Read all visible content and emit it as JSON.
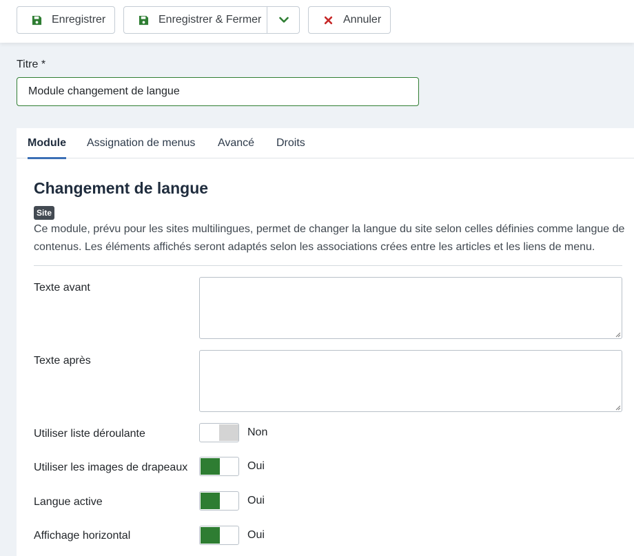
{
  "toolbar": {
    "save_label": "Enregistrer",
    "save_close_label": "Enregistrer & Fermer",
    "cancel_label": "Annuler"
  },
  "title_field": {
    "label": "Titre *",
    "value": "Module changement de langue"
  },
  "tabs": [
    {
      "label": "Module",
      "active": true
    },
    {
      "label": "Assignation de menus",
      "active": false
    },
    {
      "label": "Avancé",
      "active": false
    },
    {
      "label": "Droits",
      "active": false
    }
  ],
  "module": {
    "title": "Changement de langue",
    "badge": "Site",
    "description": "Ce module, prévu pour les sites multilingues, permet de changer la langue du site selon celles définies comme langue de contenus. Les éléments affichés seront adaptés selon les associations crées entre les articles et les liens de menu."
  },
  "fields": {
    "text_before": {
      "label": "Texte avant",
      "value": ""
    },
    "text_after": {
      "label": "Texte après",
      "value": ""
    },
    "dropdown": {
      "label": "Utiliser liste déroulante",
      "state": "Non",
      "on": false
    },
    "flags": {
      "label": "Utiliser les images de drapeaux",
      "state": "Oui",
      "on": true
    },
    "active_language": {
      "label": "Langue active",
      "state": "Oui",
      "on": true
    },
    "horizontal": {
      "label": "Affichage horizontal",
      "state": "Oui",
      "on": true
    }
  },
  "colors": {
    "accent_green": "#2e7d32",
    "cancel_red": "#c62828",
    "tab_active": "#3b6fb6"
  },
  "icons": {
    "save": "floppy-disk-icon",
    "dropdown": "chevron-down-icon",
    "cancel": "close-icon"
  }
}
